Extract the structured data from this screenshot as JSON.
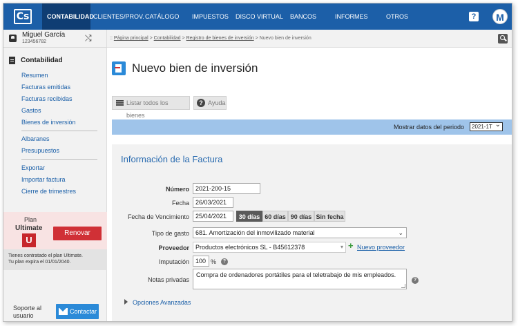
{
  "topnav": {
    "logo": "Cs",
    "items": [
      {
        "label": "CONTABILIDAD",
        "active": true
      },
      {
        "label": "CLIENTES/PROV.",
        "active": false
      },
      {
        "label": "CATÁLOGO",
        "active": false
      },
      {
        "label": "IMPUESTOS",
        "active": false
      },
      {
        "label": "DISCO VIRTUAL",
        "active": false
      },
      {
        "label": "BANCOS",
        "active": false
      },
      {
        "label": "INFORMES",
        "active": false
      },
      {
        "label": "OTROS",
        "active": false
      }
    ],
    "help": "?",
    "avatar": "M"
  },
  "user": {
    "name": "Miguel García",
    "id": "123456782"
  },
  "sidebar": {
    "section": "Contabilidad",
    "group1": [
      "Resumen",
      "Facturas emitidas",
      "Facturas recibidas",
      "Gastos",
      "Bienes de inversión"
    ],
    "group2": [
      "Albaranes",
      "Presupuestos"
    ],
    "group3": [
      "Exportar",
      "Importar factura",
      "Cierre de trimestres"
    ],
    "plan": {
      "label": "Plan",
      "name": "Ultimate",
      "logo": "U",
      "renew": "Renovar"
    },
    "plan_info": [
      "Tienes contratado el plan Ultimate.",
      "Tu plan expira el 01/01/2040."
    ],
    "support": "Soporte al usuario",
    "contact": "Contactar"
  },
  "breadcrumb": {
    "prefix": "::",
    "links": [
      "Página principal",
      "Contabilidad",
      "Registro de bienes de inversión"
    ],
    "current": "Nuevo bien de inversión",
    "sep": ">"
  },
  "page": {
    "title": "Nuevo bien de inversión"
  },
  "toolbar": {
    "list_all": "Listar todos los bienes",
    "help": "Ayuda"
  },
  "period": {
    "label": "Mostrar datos del periodo",
    "value": "2021-1T"
  },
  "form": {
    "title": "Información de la Factura",
    "numero_label": "Número",
    "numero": "2021-200-15",
    "fecha_label": "Fecha",
    "fecha": "26/03/2021",
    "venc_label": "Fecha de Vencimiento",
    "venc": "25/04/2021",
    "days": [
      "30 días",
      "60 días",
      "90 días",
      "Sin fecha"
    ],
    "tipo_label": "Tipo de gasto",
    "tipo": "681. Amortización del inmovilizado material",
    "proveedor_label": "Proveedor",
    "proveedor": "Productos electrónicos SL - B45612378",
    "nuevo_proveedor": "Nuevo proveedor",
    "imputacion_label": "Imputación",
    "imputacion": "100",
    "percent": "%",
    "notas_label": "Notas privadas",
    "notas": "Compra de ordenadores portátiles para el teletrabajo de mis empleados.",
    "advanced": "Opciones Avanzadas"
  },
  "colors": {
    "nav": "#1c5fa8",
    "nav_active": "#0f3d73",
    "period_bar": "#9fc4ea",
    "renew": "#d03036",
    "link": "#1a5fa8"
  }
}
